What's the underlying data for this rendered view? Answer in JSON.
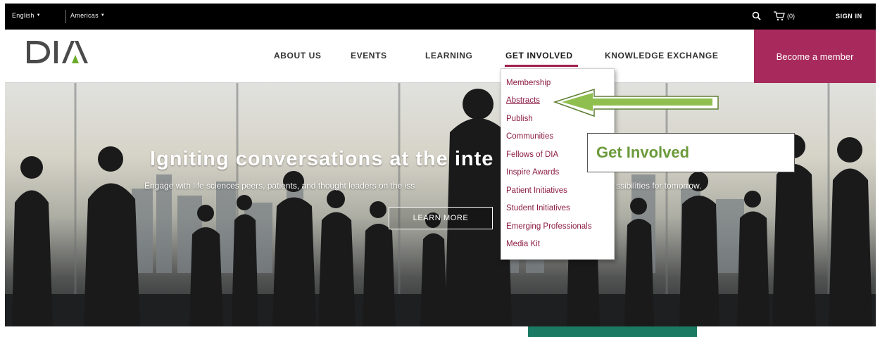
{
  "topbar": {
    "language": "English",
    "region": "Americas",
    "cart_label": "(0)",
    "signin_label": "SIGN IN"
  },
  "header": {
    "logo_text": "DIA",
    "nav": [
      "ABOUT US",
      "EVENTS",
      "LEARNING",
      "GET INVOLVED",
      "KNOWLEDGE EXCHANGE"
    ],
    "active_nav": "GET INVOLVED",
    "member_button": "Become a member"
  },
  "hero": {
    "title": "Igniting conversations at the inte",
    "subtitle": "Engage with life sciences peers, patients, and thought leaders on the iss",
    "subtitle_tail": "ssibilities for tomorrow.",
    "cta": "LEARN MORE"
  },
  "dropdown": {
    "items": [
      "Membership",
      "Abstracts",
      "Publish",
      "Communities",
      "Fellows of DIA",
      "Inspire Awards",
      "Patient Initiatives",
      "Student Initiatives",
      "Emerging Professionals",
      "Media Kit"
    ],
    "hovered_item": "Abstracts"
  },
  "annotation": {
    "callout_text": "Get Involved"
  },
  "colors": {
    "brand": "#a82a5c",
    "menu_link": "#8c1c44",
    "annotation_green": "#6b9a3b",
    "accent_stripe": "#1a7a62"
  }
}
